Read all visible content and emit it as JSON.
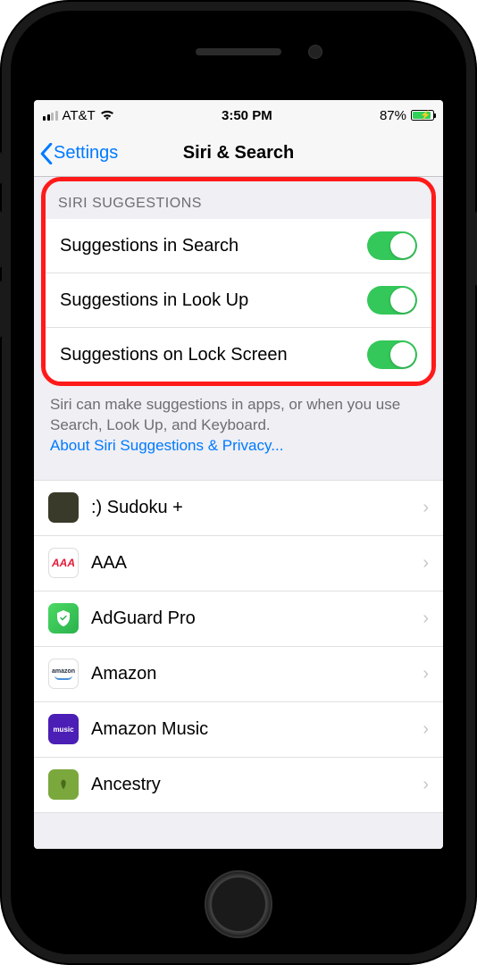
{
  "status_bar": {
    "carrier": "AT&T",
    "time": "3:50 PM",
    "battery_pct": "87%"
  },
  "nav": {
    "back": "Settings",
    "title": "Siri & Search"
  },
  "section_title": "SIRI SUGGESTIONS",
  "toggles": [
    {
      "label": "Suggestions in Search",
      "on": true
    },
    {
      "label": "Suggestions in Look Up",
      "on": true
    },
    {
      "label": "Suggestions on Lock Screen",
      "on": true
    }
  ],
  "footer": {
    "text": "Siri can make suggestions in apps, or when you use Search, Look Up, and Keyboard.",
    "link": "About Siri Suggestions & Privacy..."
  },
  "apps": [
    {
      "name": ":) Sudoku +",
      "icon_class": "icon-sudoku"
    },
    {
      "name": "AAA",
      "icon_class": "icon-aaa"
    },
    {
      "name": "AdGuard Pro",
      "icon_class": "icon-adguard"
    },
    {
      "name": "Amazon",
      "icon_class": "icon-amazon"
    },
    {
      "name": "Amazon Music",
      "icon_class": "icon-amusic"
    },
    {
      "name": "Ancestry",
      "icon_class": "icon-ancestry"
    }
  ]
}
